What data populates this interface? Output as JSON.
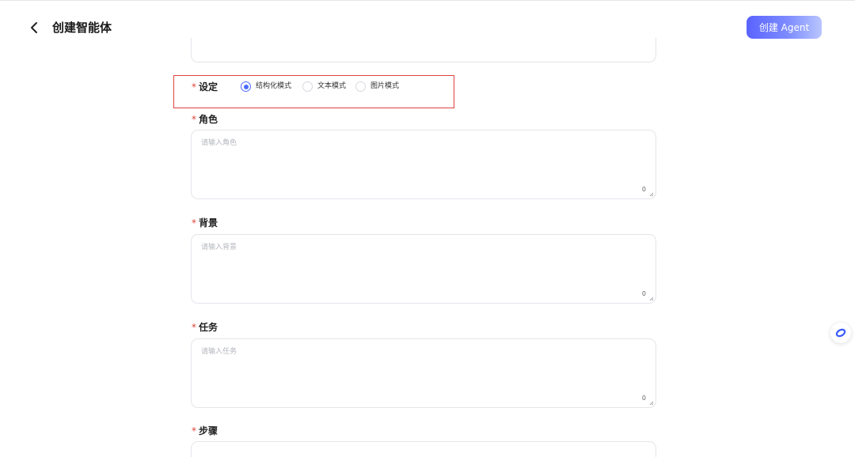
{
  "header": {
    "back_icon": "chevron-left-icon",
    "title": "创建智能体",
    "create_button_label": "创建 Agent",
    "create_button_gradient": [
      "#5a63ff",
      "#b9c6ff"
    ]
  },
  "setting": {
    "required_mark": "*",
    "label": "设定",
    "options": [
      {
        "label": "结构化模式",
        "checked": true
      },
      {
        "label": "文本模式",
        "checked": false
      },
      {
        "label": "图片模式",
        "checked": false
      }
    ],
    "highlight_color": "#e0433d"
  },
  "fields": [
    {
      "required_mark": "*",
      "label": "角色",
      "placeholder": "请输入角色",
      "counter": "0"
    },
    {
      "required_mark": "*",
      "label": "背景",
      "placeholder": "请输入背景",
      "counter": "0"
    },
    {
      "required_mark": "*",
      "label": "任务",
      "placeholder": "请输入任务",
      "counter": "0"
    },
    {
      "required_mark": "*",
      "label": "步骤"
    }
  ],
  "floating_button": {
    "icon": "assistant-ring-icon"
  },
  "colors": {
    "accent": "#4d6bfe",
    "required": "#e0433d"
  }
}
